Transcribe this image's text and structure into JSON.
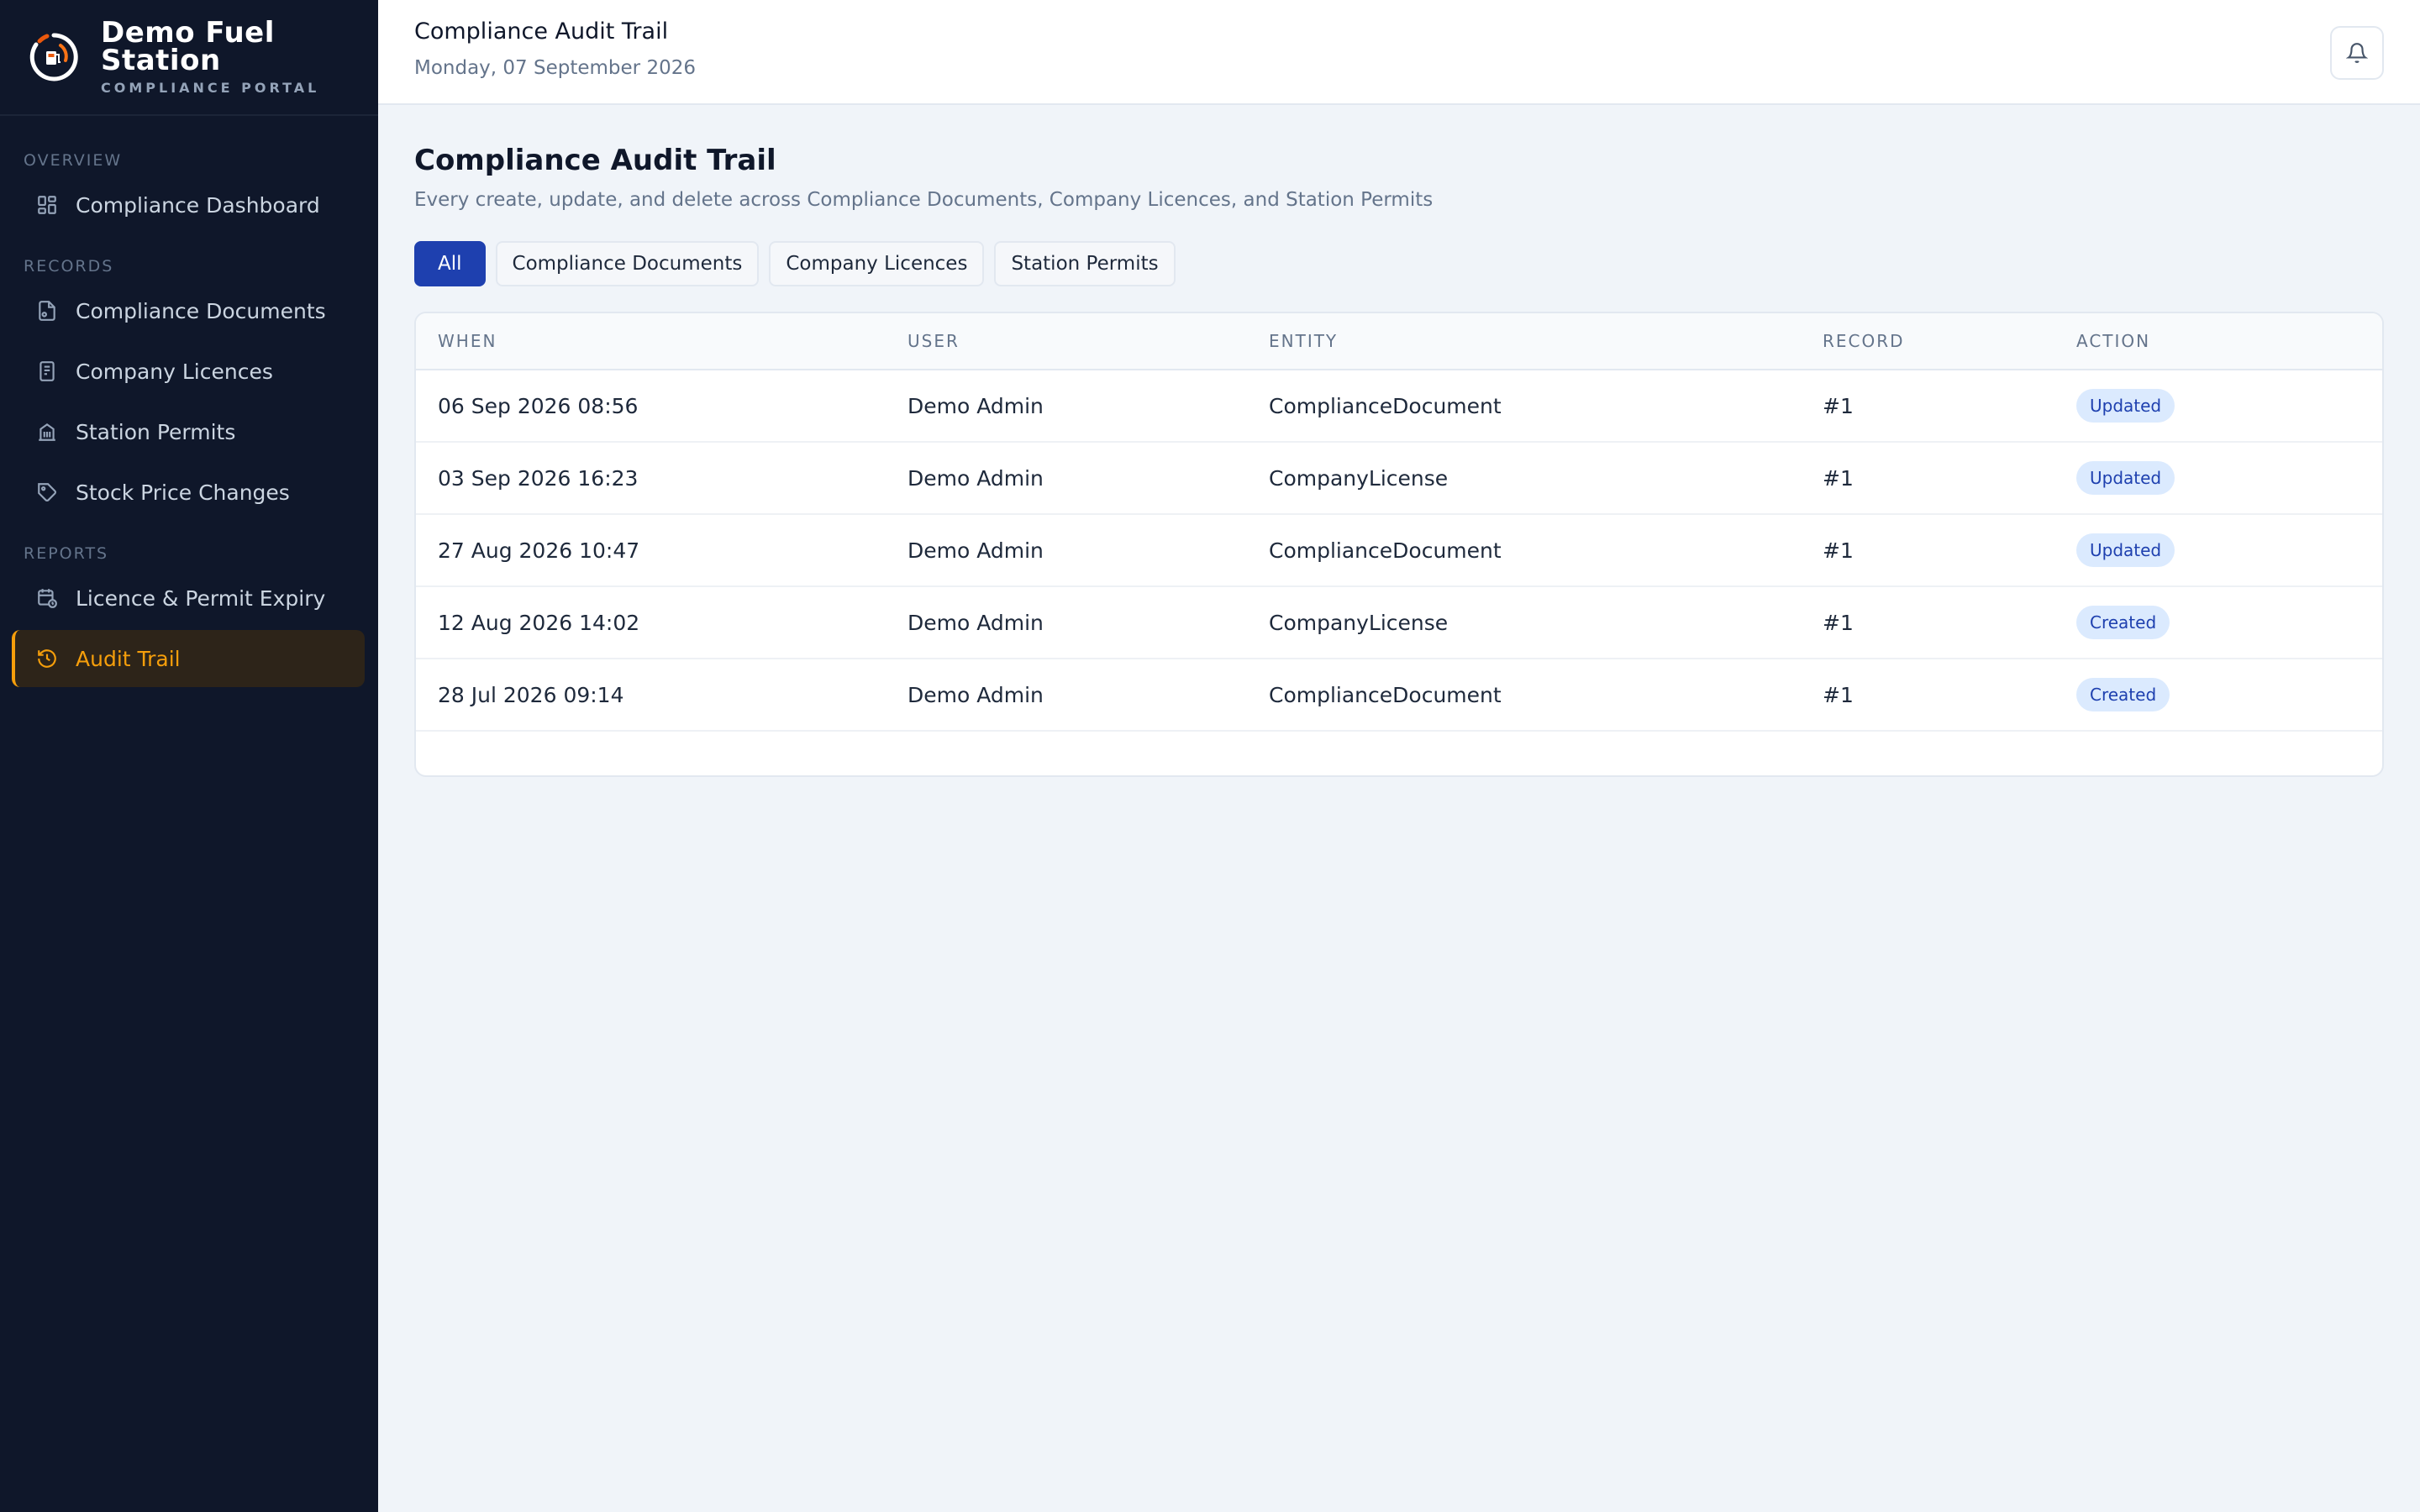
{
  "brand": {
    "name_line1": "Demo Fuel",
    "name_line2": "Station",
    "subtitle": "COMPLIANCE PORTAL",
    "logo_icon": "fuel-gauge-logo"
  },
  "sidebar": {
    "sections": [
      {
        "label": "OVERVIEW",
        "items": [
          {
            "label": "Compliance Dashboard",
            "icon": "dashboard-grid-icon"
          }
        ]
      },
      {
        "label": "RECORDS",
        "items": [
          {
            "label": "Compliance Documents",
            "icon": "document-icon"
          },
          {
            "label": "Company Licences",
            "icon": "license-document-icon"
          },
          {
            "label": "Station Permits",
            "icon": "building-icon"
          },
          {
            "label": "Stock Price Changes",
            "icon": "tag-icon"
          }
        ]
      },
      {
        "label": "REPORTS",
        "items": [
          {
            "label": "Licence & Permit Expiry",
            "icon": "calendar-clock-icon"
          },
          {
            "label": "Audit Trail",
            "icon": "history-icon",
            "active": true
          }
        ]
      }
    ]
  },
  "header": {
    "title": "Compliance Audit Trail",
    "date": "Monday, 07 September 2026",
    "bell_icon": "bell-icon"
  },
  "main": {
    "title": "Compliance Audit Trail",
    "subtitle": "Every create, update, and delete across Compliance Documents, Company Licences, and Station Permits",
    "filters": [
      {
        "label": "All",
        "active": true
      },
      {
        "label": "Compliance Documents"
      },
      {
        "label": "Company Licences"
      },
      {
        "label": "Station Permits"
      }
    ],
    "table": {
      "columns": [
        "WHEN",
        "USER",
        "ENTITY",
        "RECORD",
        "ACTION"
      ],
      "rows": [
        {
          "when": "06 Sep 2026 08:56",
          "user": "Demo Admin",
          "entity": "ComplianceDocument",
          "record": "#1",
          "action": "Updated"
        },
        {
          "when": "03 Sep 2026 16:23",
          "user": "Demo Admin",
          "entity": "CompanyLicense",
          "record": "#1",
          "action": "Updated"
        },
        {
          "when": "27 Aug 2026 10:47",
          "user": "Demo Admin",
          "entity": "ComplianceDocument",
          "record": "#1",
          "action": "Updated"
        },
        {
          "when": "12 Aug 2026 14:02",
          "user": "Demo Admin",
          "entity": "CompanyLicense",
          "record": "#1",
          "action": "Created"
        },
        {
          "when": "28 Jul 2026 09:14",
          "user": "Demo Admin",
          "entity": "ComplianceDocument",
          "record": "#1",
          "action": "Created"
        }
      ]
    }
  },
  "colors": {
    "sidebar_bg": "#0f172a",
    "accent": "#f59e0b",
    "primary": "#1e40af",
    "badge_bg": "#dbeafe"
  }
}
